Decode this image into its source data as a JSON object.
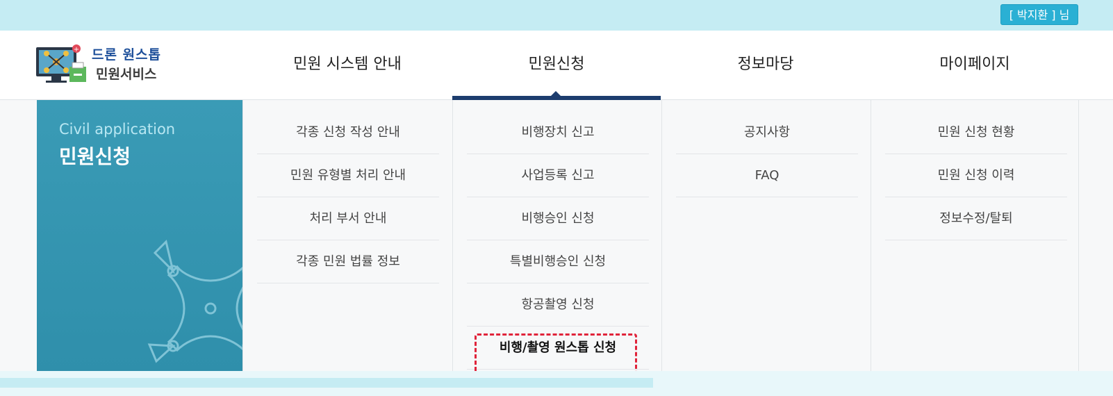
{
  "user": {
    "label": "[ 박지환 ] 님"
  },
  "logo": {
    "line1": "드론 원스톱",
    "line2": "민원서비스"
  },
  "nav": {
    "items": [
      {
        "label": "민원 시스템 안내"
      },
      {
        "label": "민원신청"
      },
      {
        "label": "정보마당"
      },
      {
        "label": "마이페이지"
      }
    ],
    "active_index": 1
  },
  "side_panel": {
    "english_title": "Civil application",
    "korean_title": "민원신청"
  },
  "menus": {
    "col1": [
      "각종 신청 작성 안내",
      "민원 유형별 처리 안내",
      "처리 부서 안내",
      "각종 민원 법률 정보"
    ],
    "col2": [
      "비행장치 신고",
      "사업등록 신고",
      "비행승인 신청",
      "특별비행승인 신청",
      "항공촬영 신청",
      "비행/촬영 원스톱 신청"
    ],
    "col3": [
      "공지사항",
      "FAQ"
    ],
    "col4": [
      "민원 신청 현황",
      "민원 신청 이력",
      "정보수정/탈퇴"
    ]
  },
  "highlighted_item": "비행/촬영 원스톱 신청",
  "colors": {
    "accent": "#2ab0d4",
    "nav_active": "#1d3d6e",
    "side_panel": "#3198b3",
    "highlight_border": "#e0233a"
  }
}
